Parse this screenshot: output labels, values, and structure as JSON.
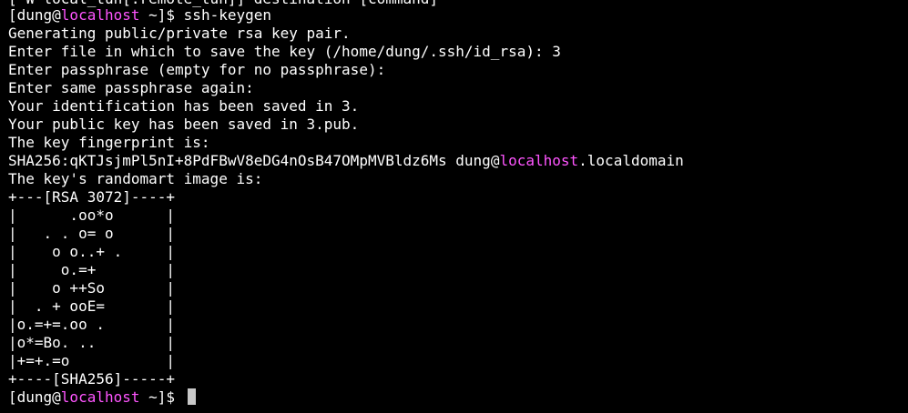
{
  "terminal": {
    "prev_line_partial": "[-W local_tun[:remote_tun]] destination [command]",
    "prompt1": {
      "open": "[dung@",
      "host": "localhost",
      "close": " ~]$ ",
      "command": "ssh-keygen"
    },
    "output": [
      "Generating public/private rsa key pair.",
      "Enter file in which to save the key (/home/dung/.ssh/id_rsa): 3",
      "Enter passphrase (empty for no passphrase):",
      "Enter same passphrase again:",
      "Your identification has been saved in 3.",
      "Your public key has been saved in 3.pub.",
      "The key fingerprint is:"
    ],
    "fingerprint": {
      "hash": "SHA256:qKTJsjmPl5nI+8PdFBwV8eDG4nOsB47OMpMVBldz6Ms ",
      "user": "dung@",
      "host": "localhost",
      "domain": ".localdomain"
    },
    "randomart_intro": "The key's randomart image is:",
    "randomart": [
      "+---[RSA 3072]----+",
      "|      .oo*o      |",
      "|   . . o= o      |",
      "|    o o..+ .     |",
      "|     o.=+        |",
      "|    o ++So       |",
      "|  . + ooE=       |",
      "|o.=+=.oo .       |",
      "|o*=Bo. ..        |",
      "|+=+.=o           |",
      "+----[SHA256]-----+"
    ],
    "prompt2": {
      "open": "[dung@",
      "host": "localhost",
      "close": " ~]$ "
    },
    "colors": {
      "background": "#000000",
      "text": "#ffffff",
      "hostname": "#ff55ff",
      "cursor": "#c8c8c8"
    }
  }
}
